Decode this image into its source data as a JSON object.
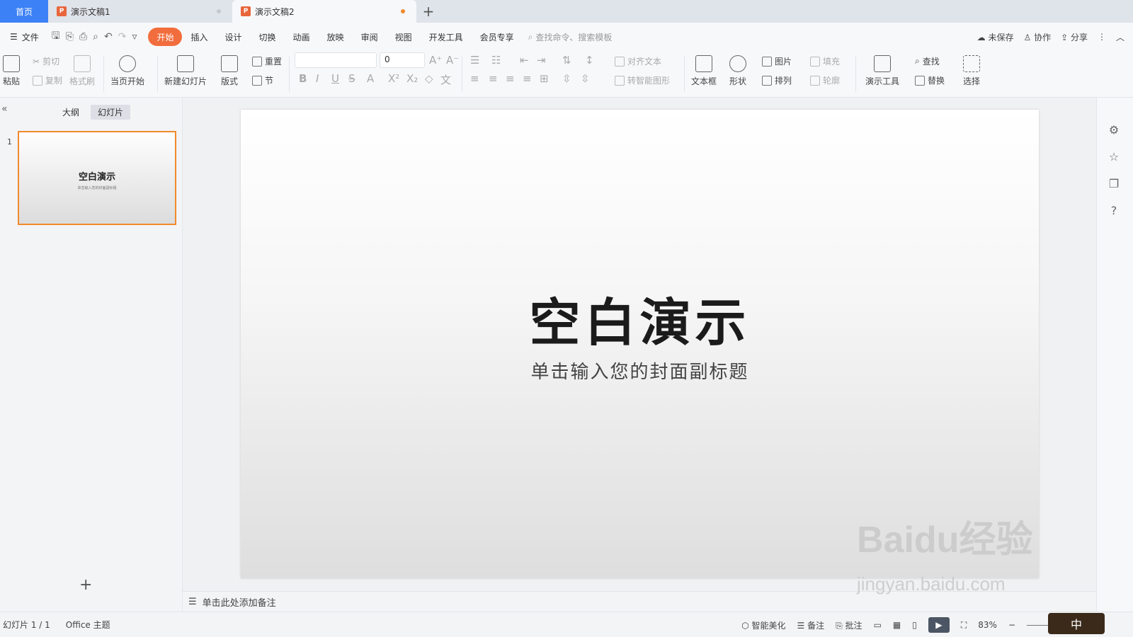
{
  "tabs": {
    "home": "首页",
    "doc1": "演示文稿1",
    "doc2": "演示文稿2",
    "add": "+"
  },
  "menu": {
    "file": "文件",
    "items": [
      "开始",
      "插入",
      "设计",
      "切换",
      "动画",
      "放映",
      "审阅",
      "视图",
      "开发工具",
      "会员专享"
    ],
    "active": "开始",
    "search_placeholder": "查找命令、搜索模板",
    "unsaved": "未保存",
    "collab": "协作",
    "share": "分享"
  },
  "ribbon": {
    "paste": "粘贴",
    "cut": "剪切",
    "copy": "复制",
    "format_painter": "格式刷",
    "play_from_current": "当页开始",
    "new_slide": "新建幻灯片",
    "layout": "版式",
    "reset": "重置",
    "section": "节",
    "font_size": "0",
    "align_text": "对齐文本",
    "smart_art": "转智能图形",
    "textbox": "文本框",
    "shape": "形状",
    "picture": "图片",
    "arrange": "排列",
    "fill": "填充",
    "outline": "轮廓",
    "present_tools": "演示工具",
    "find": "查找",
    "replace": "替换",
    "select": "选择"
  },
  "left_panel": {
    "outline_tab": "大纲",
    "slides_tab": "幻灯片",
    "slide_number": "1",
    "thumb_title": "空白演示",
    "thumb_sub": "单击输入您的封面副标题"
  },
  "slide": {
    "title": "空白演示",
    "subtitle": "单击输入您的封面副标题"
  },
  "notes": {
    "placeholder": "单击此处添加备注"
  },
  "status": {
    "slide_count": "幻灯片 1 / 1",
    "theme": "Office 主题",
    "beautify": "智能美化",
    "notes": "备注",
    "comments": "批注",
    "zoom": "83%"
  },
  "watermark": {
    "line1": "Baidu经验",
    "line2": "jingyan.baidu.com"
  },
  "ime": "中",
  "colors": {
    "accent": "#f26d3d",
    "home_tab": "#3c82f6",
    "selection": "#f08a2c"
  }
}
